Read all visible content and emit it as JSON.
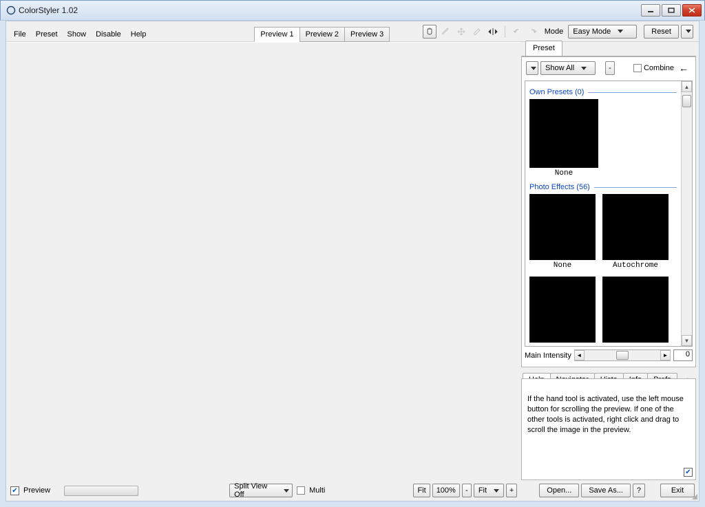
{
  "titlebar": {
    "title": "ColorStyler 1.02"
  },
  "menu": {
    "file": "File",
    "preset": "Preset",
    "show": "Show",
    "disable": "Disable",
    "help": "Help"
  },
  "previewTabs": {
    "p1": "Preview 1",
    "p2": "Preview 2",
    "p3": "Preview 3"
  },
  "mode": {
    "label": "Mode",
    "value": "Easy Mode",
    "reset": "Reset"
  },
  "presetPanel": {
    "tab": "Preset",
    "showAll": "Show All",
    "dash": "-",
    "combine": "Combine",
    "sections": {
      "own": "Own Presets (0)",
      "photo": "Photo Effects (56)"
    },
    "thumbs": {
      "none": "None",
      "autochrome": "Autochrome"
    },
    "intensity": "Main Intensity",
    "intensityVal": "0"
  },
  "infoTabs": {
    "help": "Help",
    "navigator": "Navigator",
    "histo": "Histo",
    "info": "Info",
    "prefs": "Prefs"
  },
  "helpText": "If the hand tool is activated, use the left mouse button for scrolling the preview. If one of the other tools is activated, right click and drag to scroll the image in the preview.",
  "bottom": {
    "preview": "Preview",
    "splitView": "Split View Off",
    "multi": "Multi",
    "fit": "Fit",
    "zoom": "100%",
    "fit2": "Fit",
    "open": "Open...",
    "saveAs": "Save As...",
    "help": "?",
    "exit": "Exit"
  }
}
